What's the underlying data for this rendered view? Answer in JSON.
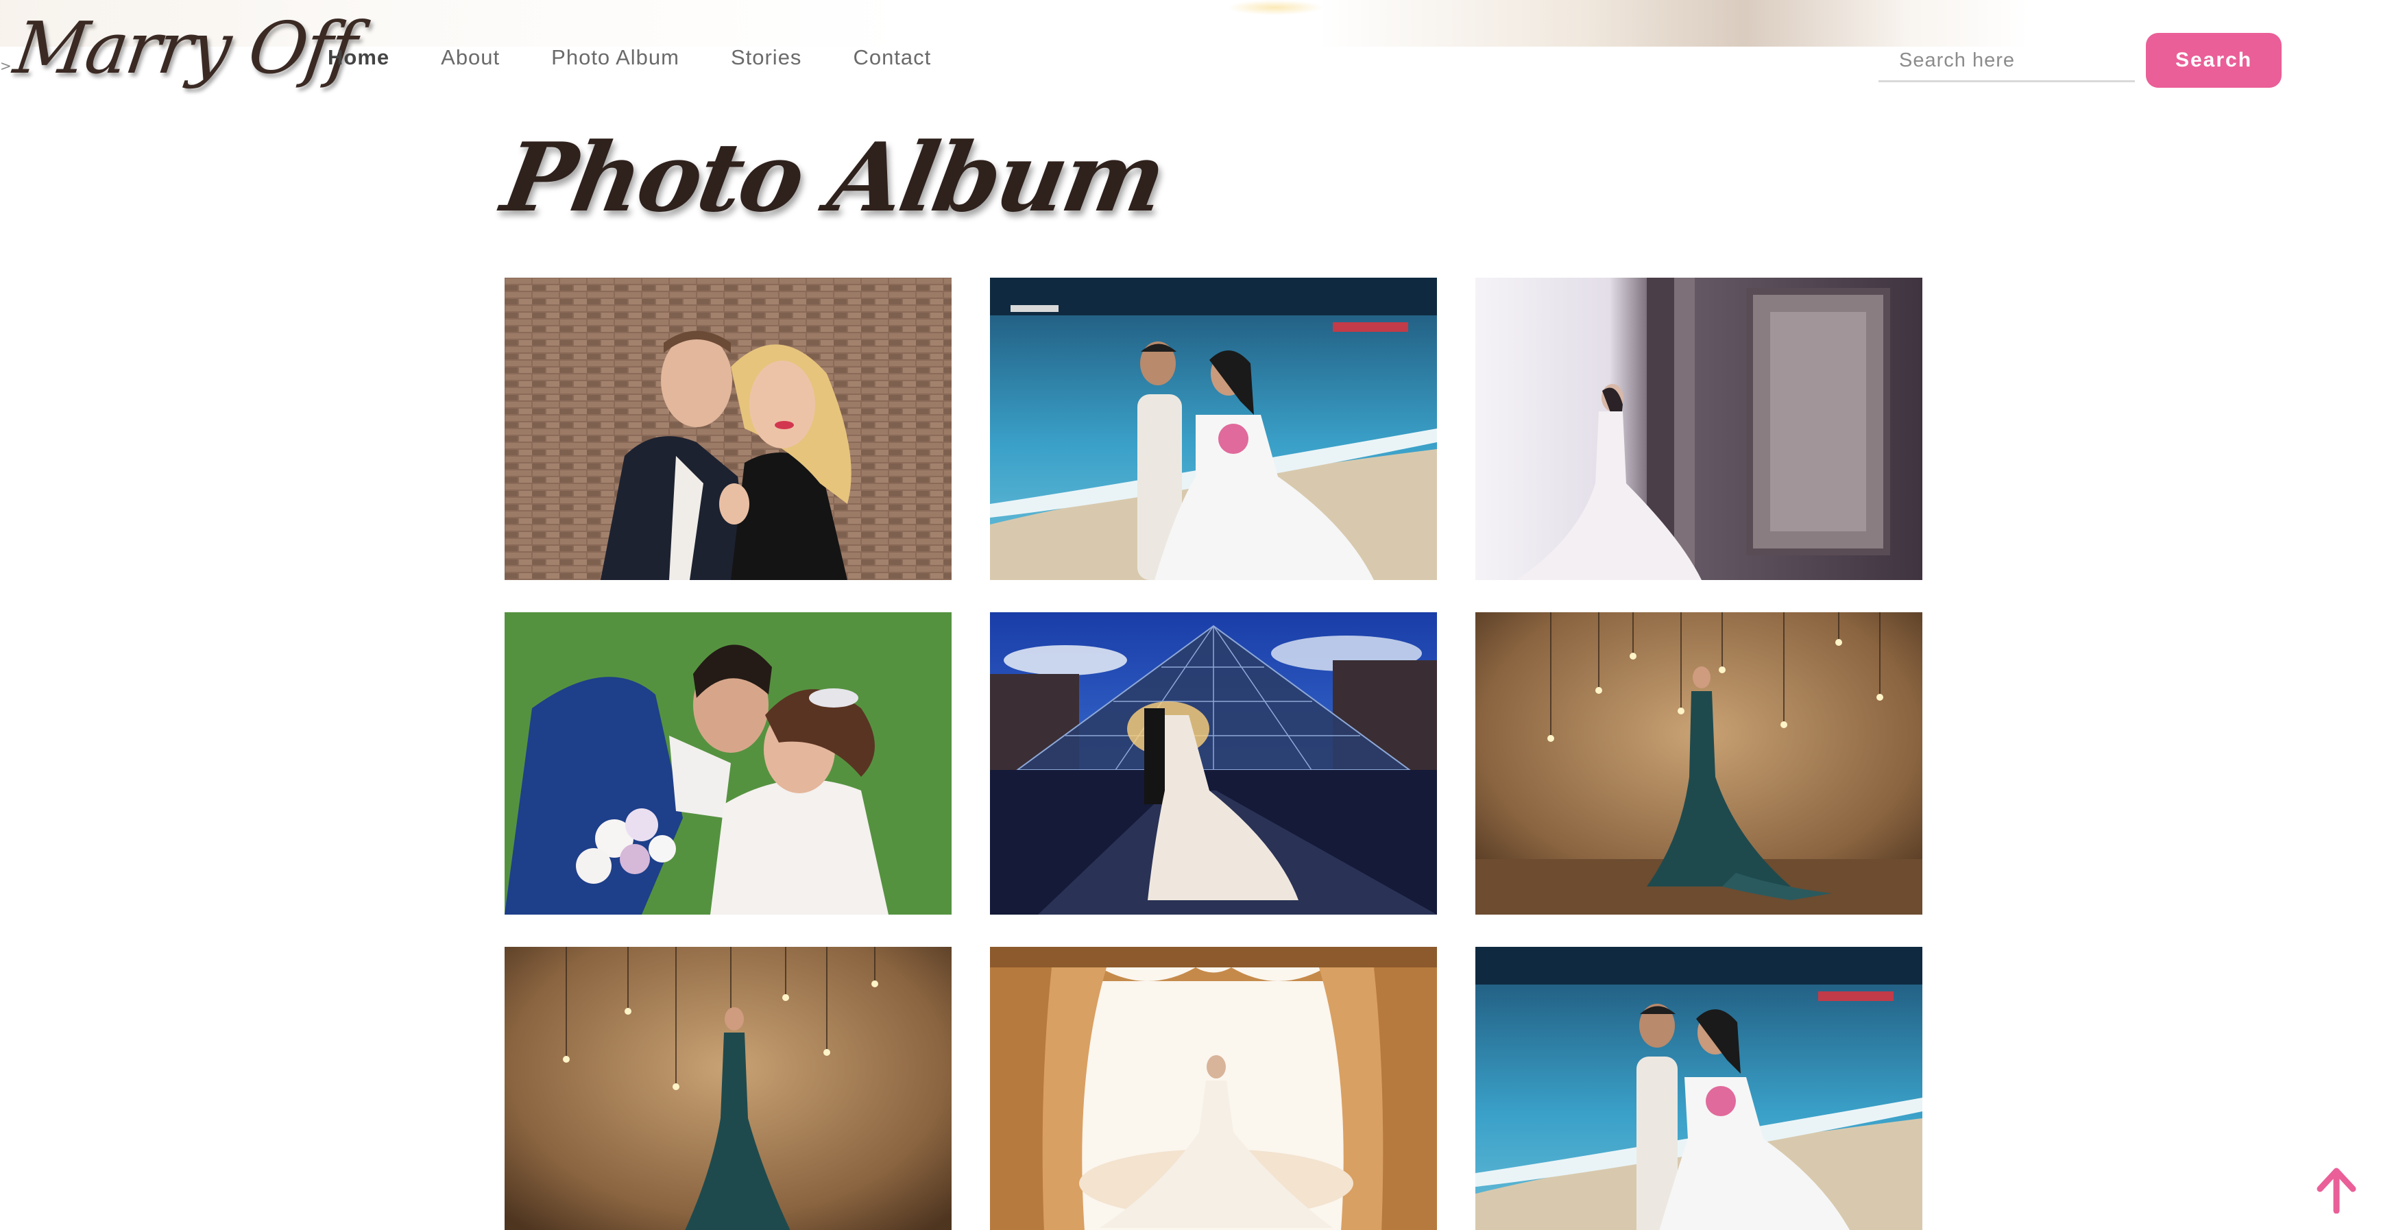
{
  "header": {
    "logo_text": "Marry Off",
    "nav": [
      {
        "label": "Home",
        "active": true
      },
      {
        "label": "About",
        "active": false
      },
      {
        "label": "Photo Album",
        "active": false
      },
      {
        "label": "Stories",
        "active": false
      },
      {
        "label": "Contact",
        "active": false
      }
    ],
    "search": {
      "placeholder": "Search here",
      "value": "",
      "button_label": "Search"
    }
  },
  "main": {
    "title": "Photo Album",
    "photos": [
      {
        "subject": "couple-brick-wall"
      },
      {
        "subject": "couple-seaside"
      },
      {
        "subject": "bride-window"
      },
      {
        "subject": "couple-grass"
      },
      {
        "subject": "couple-louvre-pyramid"
      },
      {
        "subject": "bride-lights-wall"
      },
      {
        "subject": "bride-lights-wall"
      },
      {
        "subject": "bride-curtains"
      },
      {
        "subject": "couple-seaside"
      }
    ]
  },
  "colors": {
    "accent": "#ea5f98",
    "title": "#2f211c",
    "nav_text": "#6a6a6a"
  },
  "icons": {
    "scroll_top": "arrow-up-icon"
  }
}
